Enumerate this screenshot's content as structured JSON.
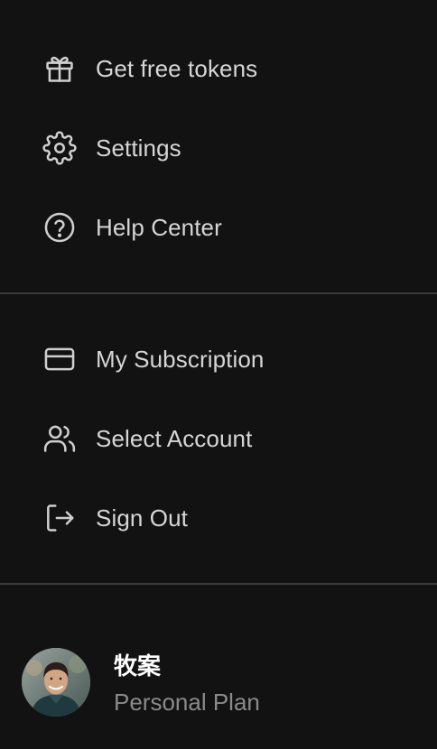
{
  "menu": {
    "items_top": [
      {
        "label": "Get free tokens",
        "icon": "gift-icon"
      },
      {
        "label": "Settings",
        "icon": "gear-icon"
      },
      {
        "label": "Help Center",
        "icon": "help-circle-icon"
      }
    ],
    "items_account": [
      {
        "label": "My Subscription",
        "icon": "credit-card-icon"
      },
      {
        "label": "Select Account",
        "icon": "users-icon"
      },
      {
        "label": "Sign Out",
        "icon": "sign-out-icon"
      }
    ]
  },
  "profile": {
    "name": "牧案",
    "plan": "Personal Plan",
    "avatar": "user-avatar-photo"
  },
  "colors": {
    "background": "#121212",
    "text": "#d6d6d6",
    "muted_text": "#8a8a8a",
    "divider": "#3a3a3a",
    "name_text": "#ffffff"
  }
}
